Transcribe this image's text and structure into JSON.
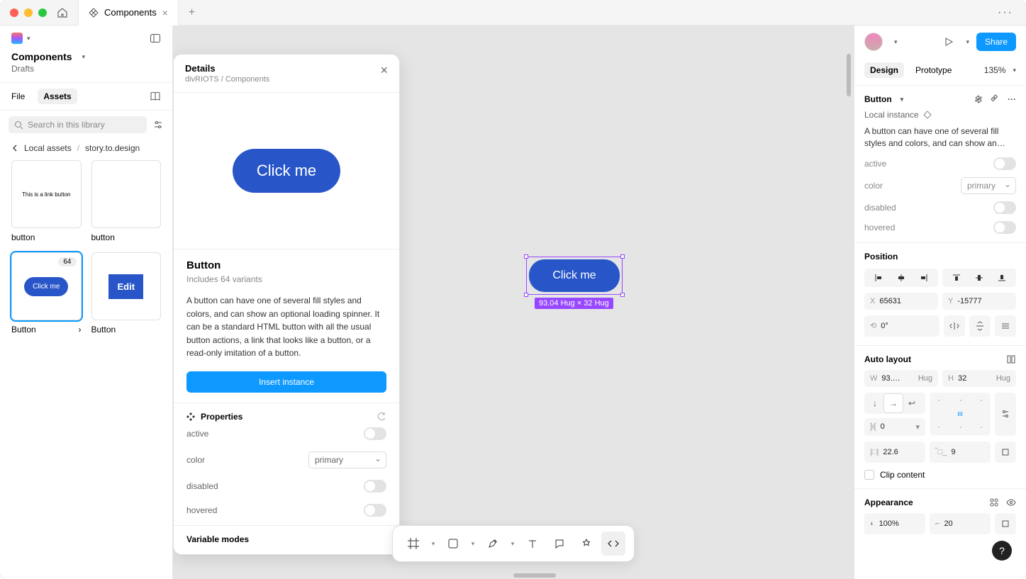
{
  "titlebar": {
    "tab_name": "Components",
    "close_glyph": "×",
    "new_tab_glyph": "+",
    "kebab": "···"
  },
  "left": {
    "project_title": "Components",
    "drafts": "Drafts",
    "file_tab": "File",
    "assets_tab": "Assets",
    "search_placeholder": "Search in this library",
    "crumb1": "Local assets",
    "crumb_sep": "/",
    "crumb2": "story.to.design",
    "assets": [
      {
        "label": "button",
        "thumb_text": "This is a link button"
      },
      {
        "label": "button",
        "thumb_text": ""
      },
      {
        "label": "Button",
        "thumb_text": "Click me",
        "badge": "64",
        "selected": true
      },
      {
        "label": "Button",
        "thumb_text": "Edit"
      }
    ]
  },
  "details": {
    "heading": "Details",
    "subhead": "divRIOTS / Components",
    "hero_text": "Click me",
    "title": "Button",
    "variants_line": "Includes 64 variants",
    "description": "A button can have one of several fill styles and colors, and can show an optional loading spinner. It can be a standard HTML button with all the usual button actions, a link that looks like a button, or a read-only imitation of a button.",
    "insert_label": "Insert instance",
    "props_label": "Properties",
    "props": {
      "active": "active",
      "color": "color",
      "color_value": "primary",
      "disabled": "disabled",
      "hovered": "hovered"
    },
    "variable_modes": "Variable modes"
  },
  "canvas": {
    "button_text": "Click me",
    "dim_label": "93.04 Hug × 32 Hug"
  },
  "right": {
    "share": "Share",
    "tab_design": "Design",
    "tab_prototype": "Prototype",
    "zoom": "135%",
    "component": {
      "name": "Button",
      "local_instance": "Local instance",
      "desc": "A button can have one of several fill styles and colors, and can show an…",
      "props": {
        "active": "active",
        "color": "color",
        "color_value": "primary",
        "disabled": "disabled",
        "hovered": "hovered"
      }
    },
    "position": {
      "label": "Position",
      "x_lbl": "X",
      "x": "65631",
      "y_lbl": "Y",
      "y": "-15777",
      "rot": "0°"
    },
    "autolayout": {
      "label": "Auto layout",
      "w_lbl": "W",
      "w": "93.…",
      "w_mode": "Hug",
      "h_lbl": "H",
      "h": "32",
      "h_mode": "Hug",
      "gap": "0",
      "pad_h": "22.6",
      "pad_v": "9",
      "clip": "Clip content"
    },
    "appearance": {
      "label": "Appearance",
      "opacity": "100%",
      "radius": "20"
    }
  }
}
